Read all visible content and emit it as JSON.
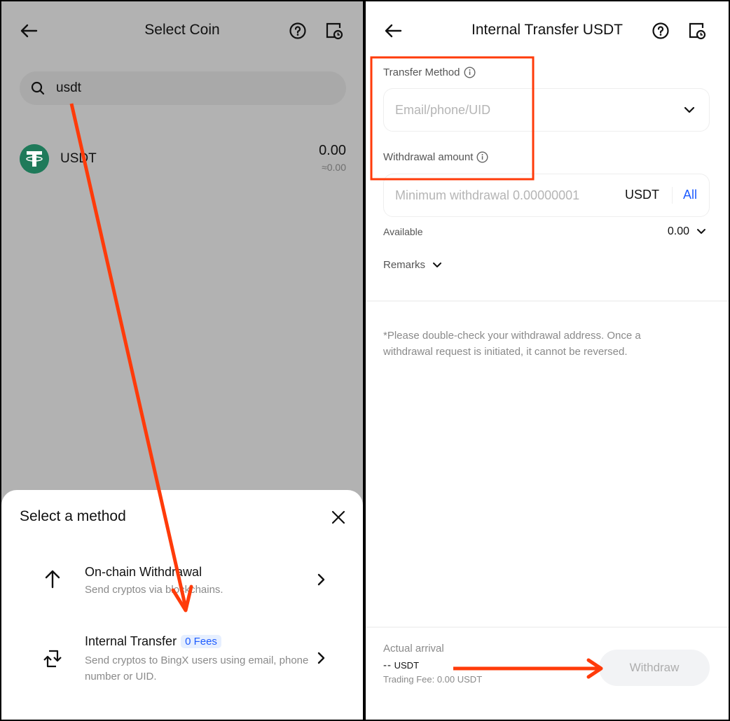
{
  "left_screen": {
    "header": {
      "title": "Select Coin"
    },
    "search": {
      "value": "usdt",
      "placeholder": ""
    },
    "coins": [
      {
        "symbol": "USDT",
        "balance": "0.00",
        "fiat": "≈0.00",
        "logo_color": "#1f7a5a"
      }
    ],
    "sheet": {
      "title": "Select a method",
      "methods": [
        {
          "title": "On-chain Withdrawal",
          "description": "Send cryptos via blockchains.",
          "icon": "arrow-up-icon"
        },
        {
          "title": "Internal Transfer",
          "badge": "0 Fees",
          "description": "Send cryptos to BingX users using email, phone number or UID.",
          "icon": "swap-icon"
        }
      ]
    }
  },
  "right_screen": {
    "header": {
      "title": "Internal Transfer USDT"
    },
    "transfer_method": {
      "label": "Transfer Method",
      "placeholder": "Email/phone/UID",
      "value": ""
    },
    "amount": {
      "label": "Withdrawal amount",
      "placeholder": "Minimum withdrawal 0.00000001",
      "unit": "USDT",
      "all_label": "All",
      "value": ""
    },
    "available": {
      "label": "Available",
      "value": "0.00"
    },
    "remarks": {
      "label": "Remarks"
    },
    "notice": "*Please double-check your withdrawal address. Once a withdrawal request is initiated, it cannot be reversed.",
    "footer": {
      "arrival_label": "Actual arrival",
      "arrival_amount": "--",
      "arrival_unit": "USDT",
      "fee": "Trading Fee: 0.00 USDT",
      "withdraw_label": "Withdraw"
    }
  },
  "colors": {
    "accent_blue": "#1e5cff",
    "annotation_red": "#ff3b0a",
    "overlay_gray": "#b2b2b2",
    "tether_green": "#1f7a5a"
  }
}
